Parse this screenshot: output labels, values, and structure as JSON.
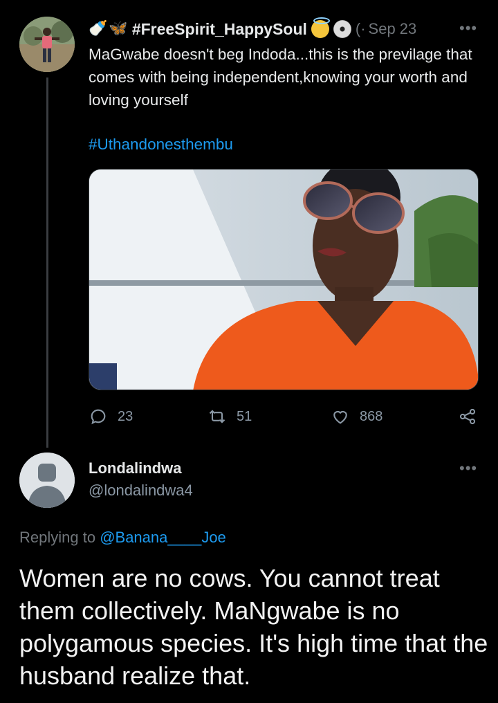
{
  "tweet": {
    "emojis": [
      "🍼",
      "🦋"
    ],
    "display_name": "#FreeSpirit_HappySoul",
    "handle_truncated": "(·",
    "date": "Sep 23",
    "more": "•••",
    "body": "MaGwabe doesn't beg Indoda...this is the previlage that comes with being independent,knowing your worth and loving yourself",
    "hashtag": "#Uthandonesthembu",
    "actions": {
      "replies": "23",
      "retweets": "51",
      "likes": "868"
    },
    "icons": [
      "reply-icon",
      "retweet-icon",
      "like-icon",
      "share-icon"
    ]
  },
  "reply": {
    "display_name": "Londalindwa",
    "handle": "@londalindwa4",
    "more": "•••",
    "replying_prefix": "Replying to ",
    "replying_mention": "@Banana____Joe",
    "body": "Women are no cows. You cannot treat them collectively. MaNgwabe is no polygamous species. It's high time that the husband realize that."
  },
  "colors": {
    "background": "#000000",
    "text": "#e7e9ea",
    "secondary": "#71767b",
    "link": "#1d9bf0"
  }
}
